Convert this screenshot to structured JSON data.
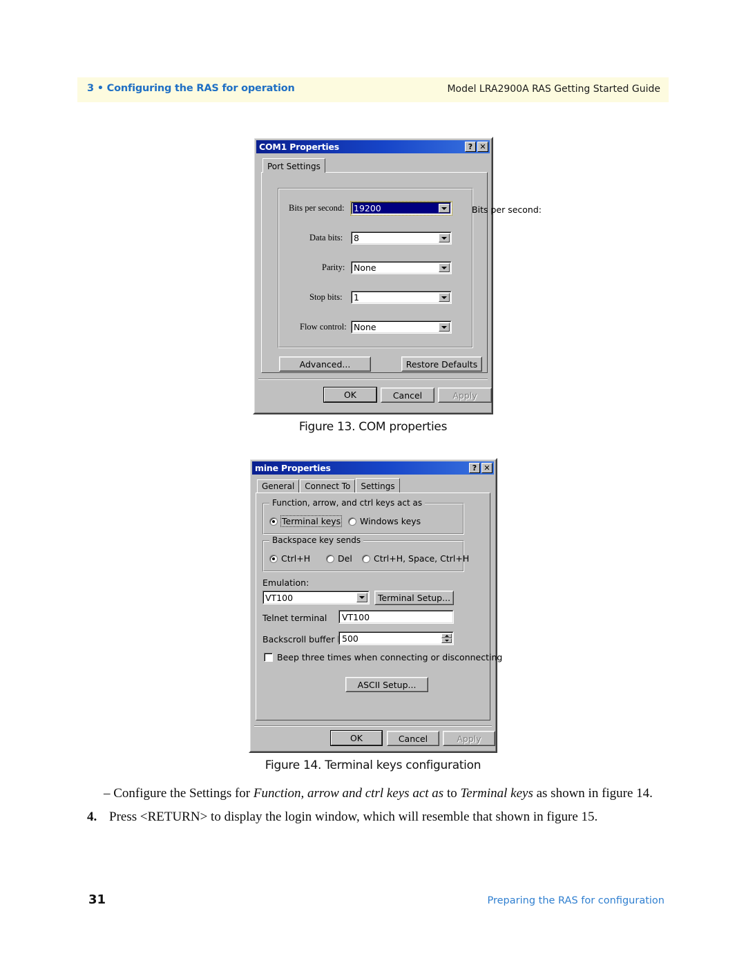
{
  "page": {
    "header": {
      "chapter": "3 • Configuring the RAS for operation",
      "guide": "Model LRA2900A RAS Getting Started Guide",
      "band_color": "#fdfbdf",
      "accent_color": "#1f6fc4"
    },
    "footer": {
      "page_number": "31",
      "running_text": "Preparing the RAS for configuration"
    }
  },
  "figure13": {
    "caption": "Figure 13. COM properties",
    "dialog": {
      "title": "COM1 Properties",
      "help_button": "?",
      "close_button": "✕",
      "tabs": [
        {
          "label": "Port Settings",
          "active": true
        }
      ],
      "fields": [
        {
          "label": "Bits per second:",
          "label_accel": "B",
          "value": "19200",
          "type": "combo",
          "selected": true
        },
        {
          "label": "Data bits:",
          "label_accel": "D",
          "value": "8",
          "type": "combo",
          "selected": false
        },
        {
          "label": "Parity:",
          "label_accel": "P",
          "value": "None",
          "type": "combo",
          "selected": false
        },
        {
          "label": "Stop bits:",
          "label_accel": "S",
          "value": "1",
          "type": "combo",
          "selected": false
        },
        {
          "label": "Flow control:",
          "label_accel": "F",
          "value": "None",
          "type": "combo",
          "selected": false
        }
      ],
      "advanced_button": "Advanced...",
      "restore_button": "Restore Defaults",
      "ok_button": "OK",
      "cancel_button": "Cancel",
      "apply_button": "Apply"
    }
  },
  "figure14": {
    "caption": "Figure 14. Terminal keys configuration",
    "dialog": {
      "title": "mine Properties",
      "help_button": "?",
      "close_button": "✕",
      "tabs": [
        {
          "label": "General",
          "active": false
        },
        {
          "label": "Connect To",
          "active": false
        },
        {
          "label": "Settings",
          "active": true
        }
      ],
      "function_keys_group": {
        "legend": "Function, arrow, and ctrl keys act as",
        "options": [
          {
            "label": "Terminal keys",
            "selected": true,
            "focused": true
          },
          {
            "label": "Windows keys",
            "selected": false,
            "focused": false
          }
        ]
      },
      "backspace_group": {
        "legend": "Backspace key sends",
        "options": [
          {
            "label": "Ctrl+H",
            "selected": true
          },
          {
            "label": "Del",
            "selected": false
          },
          {
            "label": "Ctrl+H, Space, Ctrl+H",
            "selected": false
          }
        ]
      },
      "emulation_label": "Emulation:",
      "emulation_value": "VT100",
      "terminal_setup_button": "Terminal Setup...",
      "telnet_label": "Telnet terminal",
      "telnet_value": "VT100",
      "backscroll_label": "Backscroll buffer lines:",
      "backscroll_value": "500",
      "beep_checkbox": {
        "label": "Beep three times when connecting or disconnecting",
        "checked": false
      },
      "ascii_setup_button": "ASCII Setup...",
      "ok_button": "OK",
      "cancel_button": "Cancel",
      "apply_button": "Apply"
    }
  },
  "body": {
    "bullet_line": {
      "dash": "–",
      "part1": "Configure the Settings for ",
      "italic1": "Function, arrow and ctrl keys act as",
      "part2": " to ",
      "italic2": "Terminal keys",
      "part3": " as shown in figure 14."
    },
    "step4": {
      "number": "4.",
      "text": "Press <RETURN> to display the login window, which will resemble that shown in figure 15."
    }
  }
}
